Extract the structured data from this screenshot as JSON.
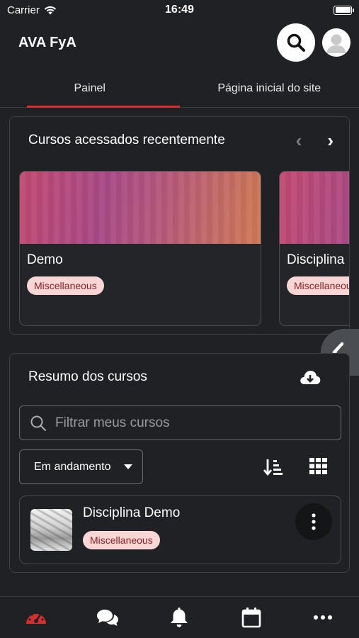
{
  "status_bar": {
    "carrier": "Carrier",
    "time": "16:49"
  },
  "header": {
    "title": "AVA FyA"
  },
  "tabs": [
    {
      "label": "Painel",
      "active": true
    },
    {
      "label": "Página inicial do site",
      "active": false
    }
  ],
  "recent": {
    "title": "Cursos acessados recentemente",
    "prev_arrow": "‹",
    "next_arrow": "›",
    "courses": [
      {
        "name": "Demo",
        "category": "Miscellaneous"
      },
      {
        "name": "Disciplina Demo",
        "category": "Miscellaneous"
      }
    ]
  },
  "summary": {
    "title": "Resumo dos cursos",
    "filter_placeholder": "Filtrar meus cursos",
    "status_filter": "Em andamento",
    "course": {
      "name": "Disciplina Demo",
      "category": "Miscellaneous"
    }
  },
  "bottom_nav": [
    "dashboard-icon",
    "messages-icon",
    "notifications-icon",
    "calendar-icon",
    "more-icon"
  ],
  "colors": {
    "accent": "#d32f2f",
    "background": "#202124",
    "tag_bg": "#f8d6d6",
    "tag_text": "#8a1f1f"
  }
}
